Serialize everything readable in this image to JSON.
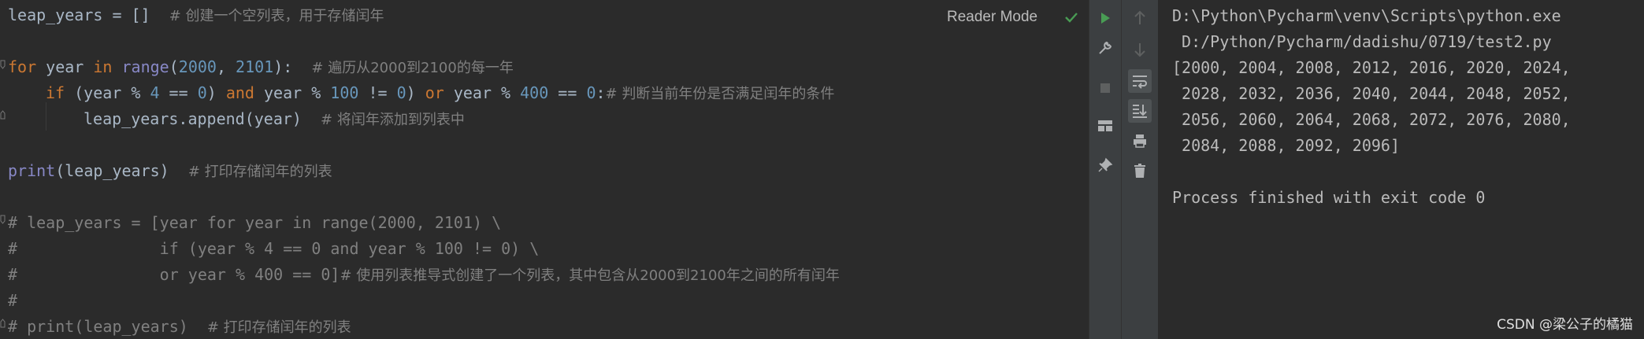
{
  "editor": {
    "reader_mode_label": "Reader Mode",
    "lines": {
      "l1": {
        "a": "leap_years = []",
        "c": "# 创建一个空列表，用于存储闰年"
      },
      "l3": {
        "kw1": "for",
        "a": " year ",
        "kw2": "in",
        "b": " ",
        "fn": "range",
        "c": "(",
        "n1": "2000",
        "d": ", ",
        "n2": "2101",
        "e": "):",
        "cm": "# 遍历从2000到2100的每一年"
      },
      "l4": {
        "kw1": "if",
        "a": " (year % ",
        "n1": "4",
        "b": " == ",
        "n2": "0",
        "c": ") ",
        "kw2": "and",
        "d": " year % ",
        "n3": "100",
        "e": " != ",
        "n4": "0",
        "f": ") ",
        "kw3": "or",
        "g": " year % ",
        "n5": "400",
        "h": " == ",
        "n6": "0",
        "i": ":",
        "cm": "# 判断当前年份是否满足闰年的条件"
      },
      "l5": {
        "a": "leap_years.append(year)",
        "cm": "# 将闰年添加到列表中"
      },
      "l7": {
        "fn": "print",
        "a": "(leap_years)",
        "cm": "# 打印存储闰年的列表"
      },
      "l9": {
        "cm": "# leap_years = [year for year in range(2000, 2101) \\"
      },
      "l10": {
        "cm": "#               if (year % 4 == 0 and year % 100 != 0) \\"
      },
      "l11": {
        "a": "#               or year % 400 == 0]",
        "cm": "# 使用列表推导式创建了一个列表，其中包含从2000到2100年之间的所有闰年"
      },
      "l12": {
        "cm": "#"
      },
      "l13": {
        "a": "# print(leap_years)",
        "cm": "# 打印存储闰年的列表"
      }
    }
  },
  "console": {
    "lines": [
      "D:\\Python\\Pycharm\\venv\\Scripts\\python.exe",
      " D:/Python/Pycharm/dadishu/0719/test2.py",
      "[2000, 2004, 2008, 2012, 2016, 2020, 2024,",
      " 2028, 2032, 2036, 2040, 2044, 2048, 2052,",
      " 2056, 2060, 2064, 2068, 2072, 2076, 2080,",
      " 2084, 2088, 2092, 2096]",
      "",
      "Process finished with exit code 0"
    ]
  },
  "watermark": "CSDN @梁公子的橘猫",
  "icons": {
    "run": "run-icon",
    "wrench": "wrench-icon",
    "stop": "stop-icon",
    "layout": "layout-icon",
    "pin": "pin-icon",
    "up": "arrow-up-icon",
    "down": "arrow-down-icon",
    "wrap": "soft-wrap-icon",
    "scroll": "scroll-to-end-icon",
    "print": "print-icon",
    "trash": "trash-icon"
  },
  "colors": {
    "keyword": "#cc7832",
    "number": "#6897bb",
    "builtin": "#8888c6",
    "comment": "#808080",
    "text": "#a9b7c6",
    "run_green": "#499c54"
  }
}
